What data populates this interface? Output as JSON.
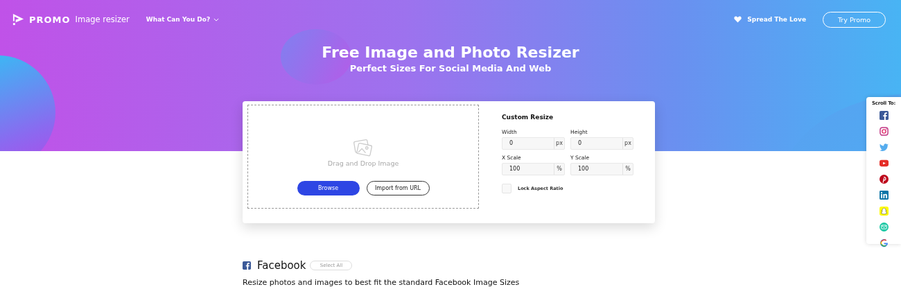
{
  "header": {
    "brand": "PROMO",
    "product": "Image resizer",
    "menu": "What Can You Do?",
    "spread": "Spread The Love",
    "cta": "Try Promo"
  },
  "hero": {
    "title": "Free Image and Photo Resizer",
    "subtitle": "Perfect Sizes For Social Media And Web"
  },
  "upload": {
    "hint": "Drag and Drop Image",
    "browse": "Browse",
    "import": "Import from URL"
  },
  "resize": {
    "title": "Custom Resize",
    "fields": [
      {
        "label": "Width",
        "value": "0",
        "unit": "px"
      },
      {
        "label": "Height",
        "value": "0",
        "unit": "px"
      },
      {
        "label": "X Scale",
        "value": "100",
        "unit": "%"
      },
      {
        "label": "Y Scale",
        "value": "100",
        "unit": "%"
      }
    ],
    "lock": {
      "label": "Lock Aspect Ratio",
      "checked": false
    }
  },
  "scroll_to": {
    "title": "Scroll To:",
    "items": [
      {
        "kind": "facebook"
      },
      {
        "kind": "instagram"
      },
      {
        "kind": "twitter"
      },
      {
        "kind": "youtube"
      },
      {
        "kind": "pinterest"
      },
      {
        "kind": "linkedin"
      },
      {
        "kind": "snapchat"
      },
      {
        "kind": "email"
      },
      {
        "kind": "google"
      }
    ]
  },
  "section": {
    "title": "Facebook",
    "select_all": "Select All",
    "description": "Resize photos and images to best fit the standard Facebook Image Sizes"
  }
}
